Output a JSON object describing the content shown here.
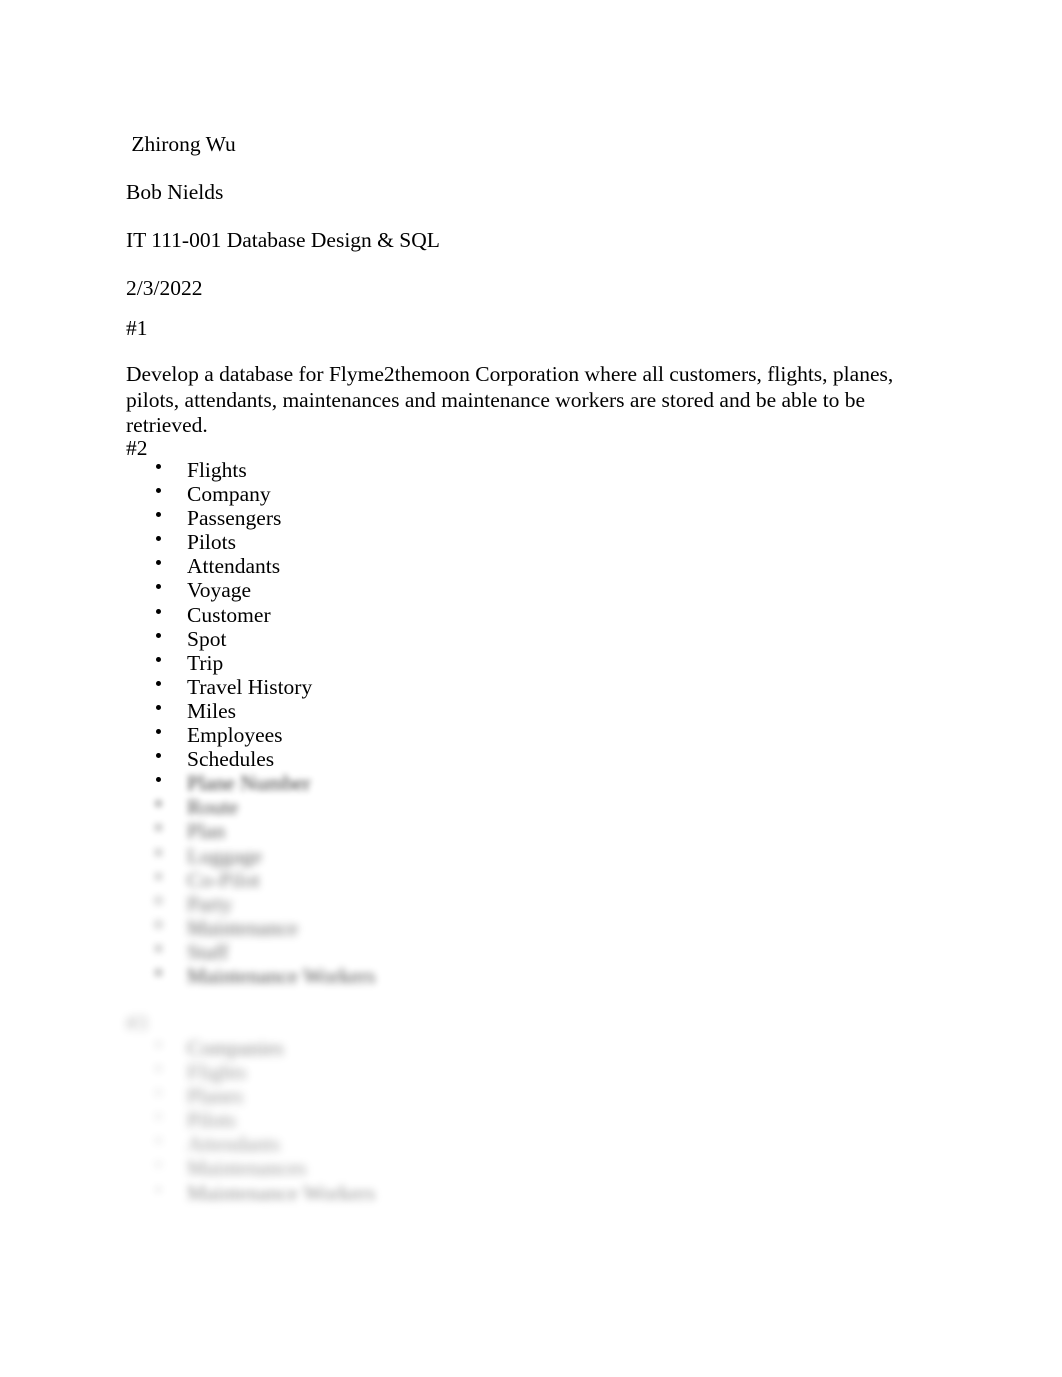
{
  "document": {
    "background_color": "#ffffff",
    "text_color": "#000000",
    "header_lines": [
      " Zhirong Wu",
      "Bob Nields",
      "IT 111-001 Database Design & SQL",
      "2/3/2022"
    ]
  },
  "section_one": {
    "heading": "#1",
    "body": "Develop a database for Flyme2themoon Corporation where all customers, flights, planes, pilots, attendants, maintenances and maintenance workers are stored and be able to be retrieved."
  },
  "section_two": {
    "heading": "#2",
    "items_visible": [
      "Flights",
      "Company",
      "Passengers",
      "Pilots",
      "Attendants",
      "Voyage",
      "Customer",
      "Spot",
      "Trip",
      "Travel History",
      "Miles",
      "Employees",
      "Schedules"
    ],
    "items_obscured": [
      "Plane Number",
      "Route",
      "Plan",
      "Luggage",
      "Co-Pilot",
      "Party",
      "Maintenance",
      "Staff",
      "Maintenance Workers"
    ]
  },
  "section_three": {
    "heading": "#3",
    "items_obscured": [
      "Companies",
      "Flights",
      "Planes",
      "Pilots",
      "Attendants",
      "Maintenances",
      "Maintenance Workers"
    ]
  }
}
